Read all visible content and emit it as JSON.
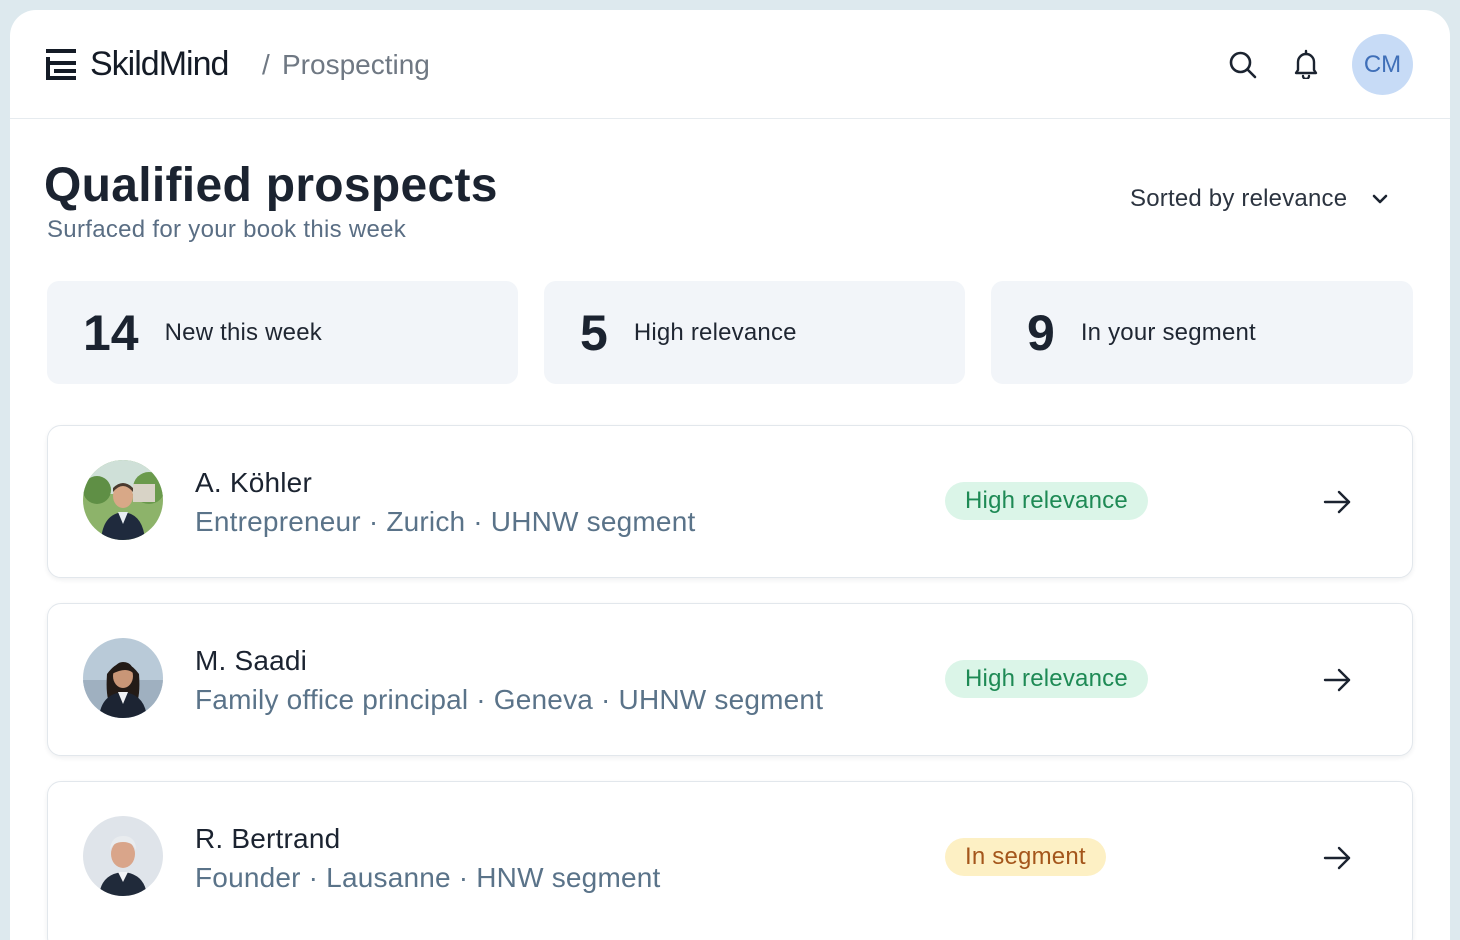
{
  "header": {
    "brand": "SkildMind",
    "breadcrumb_separator": "/",
    "breadcrumb": "Prospecting",
    "user_initials": "CM",
    "icons": [
      "logo-icon",
      "search-icon",
      "bell-icon"
    ]
  },
  "page": {
    "title": "Qualified prospects",
    "subtitle": "Surfaced for your book this week",
    "sort_label": "Sorted by relevance"
  },
  "stats": [
    {
      "value": "14",
      "label": "New this week"
    },
    {
      "value": "5",
      "label": "High relevance"
    },
    {
      "value": "9",
      "label": "In your segment"
    }
  ],
  "prospects": [
    {
      "name": "A. Köhler",
      "details": "Entrepreneur · Zurich · UHNW segment",
      "badge": "High relevance",
      "badge_kind": "high"
    },
    {
      "name": "M. Saadi",
      "details": "Family office principal · Geneva · UHNW segment",
      "badge": "High relevance",
      "badge_kind": "high"
    },
    {
      "name": "R. Bertrand",
      "details": "Founder · Lausanne · HNW segment",
      "badge": "In segment",
      "badge_kind": "segment"
    }
  ],
  "colors": {
    "high_relevance_bg": "#dbf5e8",
    "high_relevance_text": "#1e8a55",
    "segment_bg": "#fdf0c4",
    "segment_text": "#a4561b",
    "avatar_bg": "#c7dbf6",
    "avatar_text": "#3f6fb8"
  }
}
